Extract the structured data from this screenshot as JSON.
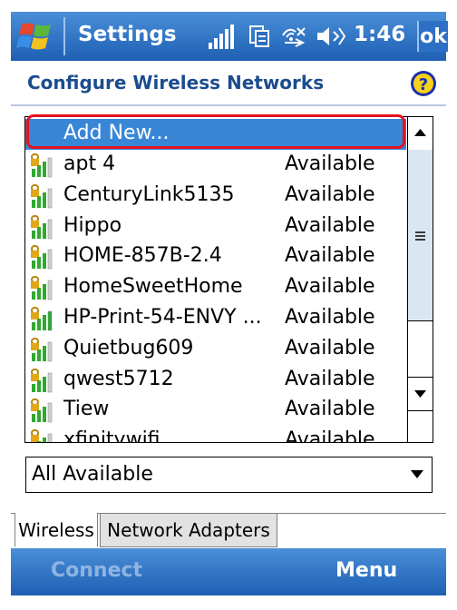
{
  "titlebar": {
    "app_title": "Settings",
    "clock": "1:46",
    "ok_label": "ok"
  },
  "header": {
    "title": "Configure Wireless Networks"
  },
  "networks": {
    "add_new": "Add New...",
    "items": [
      {
        "ssid": "apt 4",
        "status": "Available"
      },
      {
        "ssid": "CenturyLink5135",
        "status": "Available"
      },
      {
        "ssid": "Hippo",
        "status": "Available"
      },
      {
        "ssid": "HOME-857B-2.4",
        "status": "Available"
      },
      {
        "ssid": "HomeSweetHome",
        "status": "Available"
      },
      {
        "ssid": "HP-Print-54-ENVY ...",
        "status": "Available"
      },
      {
        "ssid": "Quietbug609",
        "status": "Available"
      },
      {
        "ssid": "qwest5712",
        "status": "Available"
      },
      {
        "ssid": "Tiew",
        "status": "Available"
      },
      {
        "ssid": "xfinitywifi",
        "status": "Available"
      }
    ]
  },
  "filter": {
    "selected": "All Available"
  },
  "tabs": [
    {
      "label": "Wireless"
    },
    {
      "label": "Network Adapters"
    }
  ],
  "softkeys": {
    "left": "Connect",
    "right": "Menu"
  },
  "colors": {
    "titlebar": "#2d6fc4",
    "selection": "#3a86d6",
    "highlight_ring": "#e0141e",
    "header_text": "#1b4c8e"
  }
}
